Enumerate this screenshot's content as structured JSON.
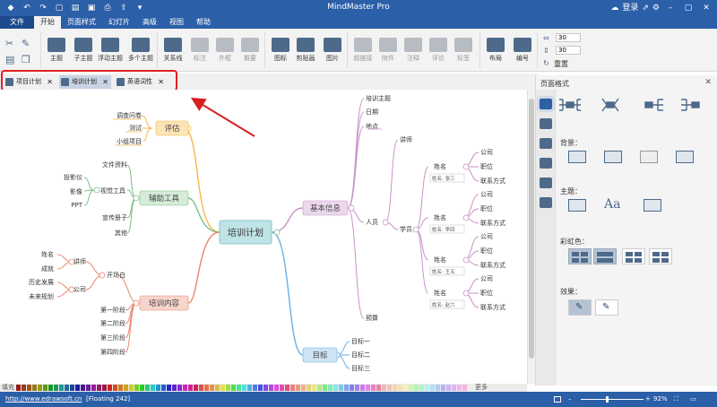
{
  "app": {
    "title": "MindMaster Pro",
    "login": "登录"
  },
  "menu": {
    "file": "文件",
    "tabs": [
      "开始",
      "页面样式",
      "幻灯片",
      "高级",
      "视图",
      "帮助"
    ],
    "active_tab": "开始"
  },
  "ribbon": {
    "buttons": [
      {
        "label": "主题",
        "enabled": true
      },
      {
        "label": "子主题",
        "enabled": true
      },
      {
        "label": "浮动主题",
        "enabled": true
      },
      {
        "label": "多个主题",
        "enabled": true
      },
      {
        "label": "关系线",
        "enabled": true
      },
      {
        "label": "标注",
        "enabled": false
      },
      {
        "label": "外框",
        "enabled": false
      },
      {
        "label": "概要",
        "enabled": false
      },
      {
        "label": "图标",
        "enabled": true
      },
      {
        "label": "剪贴画",
        "enabled": true
      },
      {
        "label": "图片",
        "enabled": true
      },
      {
        "label": "超链接",
        "enabled": false
      },
      {
        "label": "附件",
        "enabled": false
      },
      {
        "label": "注释",
        "enabled": false
      },
      {
        "label": "评论",
        "enabled": false
      },
      {
        "label": "标签",
        "enabled": false
      },
      {
        "label": "布局",
        "enabled": true
      },
      {
        "label": "编号",
        "enabled": true
      }
    ],
    "spin_h": "30",
    "spin_v": "30",
    "reset": "重置"
  },
  "doc_tabs": [
    {
      "label": "项目计划",
      "active": false
    },
    {
      "label": "培训计划",
      "active": true
    },
    {
      "label": "英语词性",
      "active": false
    }
  ],
  "mindmap": {
    "center": "培训计划",
    "branches": {
      "pinggu": {
        "label": "评估",
        "children": [
          "调查问卷",
          "测试",
          "小组项目"
        ]
      },
      "fuzhu": {
        "label": "辅助工具",
        "children": [
          "文件资料",
          "视觉工具",
          "宣传册子",
          "其他"
        ],
        "visual_children": [
          "投影仪",
          "影像",
          "PPT"
        ]
      },
      "neirong": {
        "label": "培训内容",
        "children": [
          "开场白",
          "第一阶段",
          "第二阶段",
          "第三阶段",
          "第四阶段"
        ],
        "kaichang": [
          "讲师",
          "公司"
        ],
        "jiangshi": [
          "姓名",
          "成就"
        ],
        "gongsi": [
          "历史发展",
          "未来规划"
        ]
      },
      "jiben": {
        "label": "基本信息",
        "children": [
          "培训主题",
          "日期",
          "地点",
          "人员",
          "预算"
        ],
        "renyuan": [
          "讲师",
          "学员"
        ]
      },
      "mubiao": {
        "label": "目标",
        "children": [
          "目标一",
          "目标二",
          "目标三"
        ]
      }
    },
    "students": [
      {
        "name_label": "姓名",
        "name": "姓名: 张三",
        "fields": [
          "公司",
          "职位",
          "联系方式"
        ]
      },
      {
        "name_label": "姓名",
        "name": "姓名: 李四",
        "fields": [
          "公司",
          "职位",
          "联系方式"
        ]
      },
      {
        "name_label": "姓名",
        "name": "姓名: 王五",
        "fields": [
          "公司",
          "职位",
          "联系方式"
        ]
      },
      {
        "name_label": "姓名",
        "name": "姓名: 赵六",
        "fields": [
          "公司",
          "职位",
          "联系方式"
        ]
      }
    ],
    "colors": {
      "pinggu": "#f5b84a",
      "fuzhu": "#7fbf8a",
      "neirong": "#e8866c",
      "jiben": "#c893c8",
      "mubiao": "#6aaee0",
      "center_fill": "#bfe3e6"
    }
  },
  "panel": {
    "title": "页面格式",
    "background": "背景：",
    "theme": "主题：",
    "rainbow": "彩虹色：",
    "effect": "效果："
  },
  "palette": {
    "fill": "填充",
    "more": "更多"
  },
  "status": {
    "url": "http://www.edrawsoft.cn",
    "floating": "[Floating 242]",
    "zoom": "92%"
  }
}
